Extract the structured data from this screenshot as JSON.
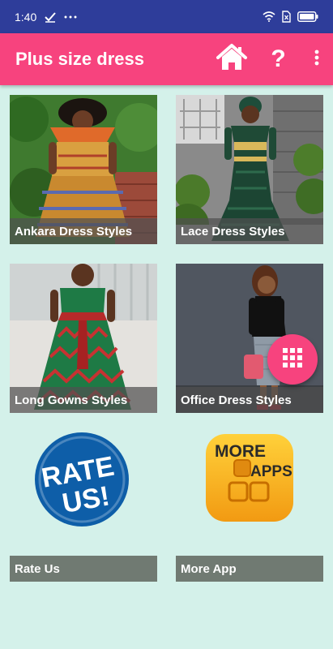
{
  "status_bar": {
    "time": "1:40",
    "icons": [
      "checkmark-icon",
      "more-dots-icon",
      "wifi-icon",
      "sim-icon",
      "battery-icon"
    ]
  },
  "app_bar": {
    "title": "Plus size dress",
    "background": "#f7437e",
    "actions": [
      "home-icon",
      "help-icon",
      "more-vert-icon"
    ],
    "help_glyph": "?"
  },
  "tiles": [
    {
      "label": "Ankara Dress Styles"
    },
    {
      "label": "Lace Dress Styles"
    },
    {
      "label": "Long Gowns Styles"
    },
    {
      "label": "Office Dress Styles"
    },
    {
      "label": "Rate Us",
      "badge_line1": "RATE",
      "badge_line2": "US!"
    },
    {
      "label": "More App",
      "icon_line1": "MORE",
      "icon_line2": "APPS"
    }
  ],
  "fab": {
    "icon": "grid-icon",
    "color": "#f7437e"
  },
  "colors": {
    "status_bar": "#2e3d9a",
    "background": "#d4f1ea",
    "caption": "#707a72"
  }
}
